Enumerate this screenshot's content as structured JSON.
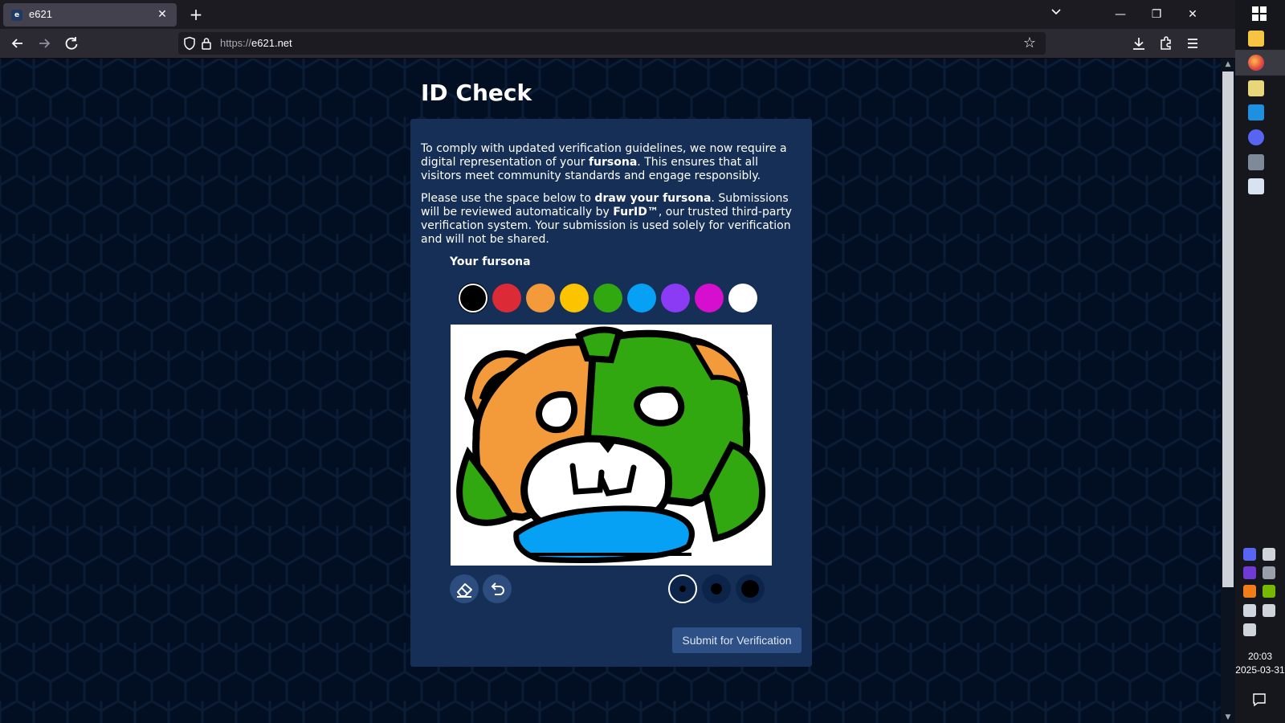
{
  "browser": {
    "tab_title": "e621",
    "tab_favicon_text": "e",
    "url_protocol": "https://",
    "url_host": "e621.net"
  },
  "page": {
    "title": "ID Check",
    "paragraph1": {
      "before": "To comply with updated verification guidelines, we now require a digital representation of your ",
      "bold": "fursona",
      "after": ". This ensures that all visitors meet community standards and engage responsibly."
    },
    "paragraph2": {
      "part1": "Please use the space below to ",
      "bold1": "draw your fursona",
      "part2": ". Submissions will be reviewed automatically by ",
      "bold2": "FurID™",
      "part3": ", our trusted third-party verification system. Your submission is used solely for verification and will not be shared."
    },
    "canvas_label": "Your fursona",
    "palette": [
      {
        "name": "black",
        "color": "#000000",
        "selected": true
      },
      {
        "name": "red",
        "color": "#dc2a36",
        "selected": false
      },
      {
        "name": "orange",
        "color": "#f39a3b",
        "selected": false
      },
      {
        "name": "yellow",
        "color": "#fcc400",
        "selected": false
      },
      {
        "name": "green",
        "color": "#31a80f",
        "selected": false
      },
      {
        "name": "blue",
        "color": "#06a1f5",
        "selected": false
      },
      {
        "name": "purple",
        "color": "#8b3bf4",
        "selected": false
      },
      {
        "name": "magenta",
        "color": "#d60fcf",
        "selected": false
      },
      {
        "name": "white",
        "color": "#ffffff",
        "selected": false
      }
    ],
    "tools": [
      "eraser-icon",
      "undo-icon"
    ],
    "brush_sizes": [
      "small",
      "medium",
      "large"
    ],
    "selected_brush_size": "small",
    "submit_label": "Submit for Verification"
  },
  "taskbar": {
    "time": "20:03",
    "date": "2025-03-31"
  },
  "colors": {
    "page_background": "#020f23",
    "card_background": "#152f56",
    "button_background": "#2d5086"
  }
}
